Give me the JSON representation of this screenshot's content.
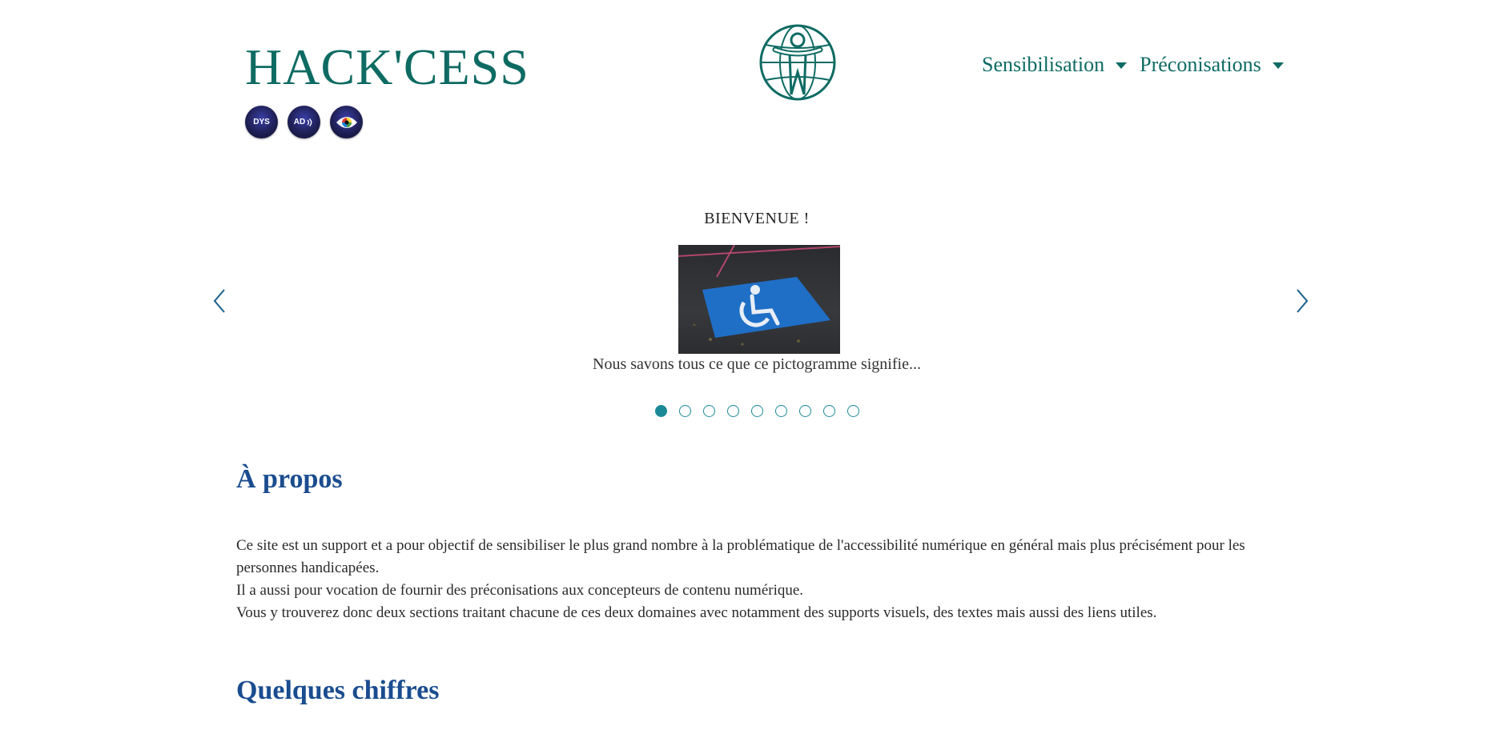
{
  "header": {
    "brand": "HACK'CESS",
    "a11y_tools": [
      {
        "label": "DYS",
        "icon": "dys-icon"
      },
      {
        "label": "AD",
        "icon": "audio-description-icon"
      },
      {
        "label": "",
        "icon": "eye-icon"
      }
    ],
    "logo_icon": "accessibility-globe-icon",
    "nav": [
      {
        "label": "Sensibilisation"
      },
      {
        "label": "Préconisations"
      }
    ]
  },
  "carousel": {
    "title": "BIENVENUE !",
    "caption": "Nous savons tous ce que ce pictogramme signifie...",
    "image_icon": "wheelchair-parking-icon",
    "total_slides": 9,
    "active_slide": 1,
    "accent_color": "#1c8a96"
  },
  "about": {
    "title": "À propos",
    "lines": [
      "Ce site est un support et a pour objectif de sensibiliser le plus grand nombre à la problématique de l'accessibilité numérique en général mais plus précisément pour les personnes handicapées.",
      "Il a aussi pour vocation de fournir des  préconisations aux concepteurs de contenu numérique.",
      "Vous y trouverez donc deux sections traitant chacune de ces deux domaines avec notamment des supports visuels, des textes mais aussi des liens utiles."
    ]
  },
  "figures": {
    "title": "Quelques chiffres"
  },
  "colors": {
    "brand": "#0e6b63",
    "heading": "#1a4d8f"
  }
}
